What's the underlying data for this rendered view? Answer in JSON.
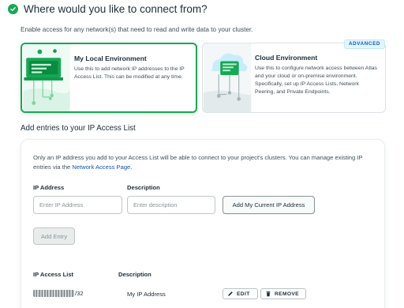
{
  "header": {
    "title": "Where would you like to connect from?",
    "check_icon": "check-circle-icon",
    "accent_color": "#13aa52"
  },
  "subtitle": "Enable access for any network(s) that need to read and write data to your cluster.",
  "options": [
    {
      "title": "My Local Environment",
      "description": "Use this to add network IP addresses to the IP Access List. This can be modified at any time.",
      "selected": true,
      "icon": "laptop-network-illustration"
    },
    {
      "title": "Cloud Environment",
      "description": "Use this to configure network access between Atlas and your cloud or on-premise environment. Specifically, set up IP Access Lists, Network Peering, and Private Endpoints.",
      "badge": "ADVANCED",
      "selected": false,
      "icon": "cloud-network-illustration"
    }
  ],
  "access_section": {
    "title": "Add entries to your IP Access List",
    "info_text": "Only an IP address you add to your Access List will be able to connect to your project's clusters. You can manage existing IP entries via the",
    "info_link": "Network Access Page",
    "info_suffix": ".",
    "ip_label": "IP Address",
    "ip_placeholder": "Enter IP Address",
    "desc_label": "Description",
    "desc_placeholder": "Enter description",
    "current_ip_button": "Add My Current IP Address",
    "add_entry_button": "Add Entry"
  },
  "list": {
    "headers": [
      "IP Access List",
      "Description"
    ],
    "rows": [
      {
        "ip_suffix": "/32",
        "description": "My IP Address"
      }
    ],
    "edit_label": "EDIT",
    "remove_label": "REMOVE"
  }
}
